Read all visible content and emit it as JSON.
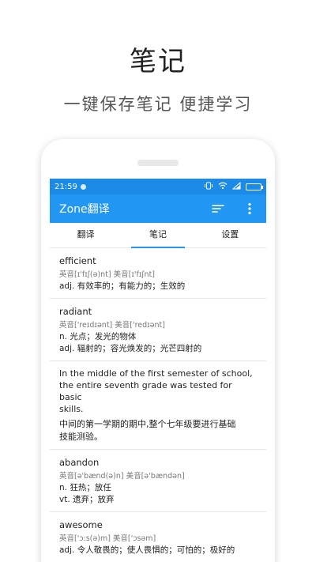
{
  "promo": {
    "title": "笔记",
    "subtitle": "一键保存笔记  便捷学习"
  },
  "status_bar": {
    "time": "21:59"
  },
  "app_bar": {
    "title": "Zone翻译"
  },
  "tabs": [
    {
      "label": "翻译",
      "active": false
    },
    {
      "label": "笔记",
      "active": true
    },
    {
      "label": "设置",
      "active": false
    }
  ],
  "entries": [
    {
      "word": "efficient",
      "phonetic": "英音[ɪ'fɪʃ(ə)nt] 美音[ɪ'fɪʃnt]",
      "meanings": [
        "adj. 有效率的；有能力的；生效的"
      ]
    },
    {
      "word": "radiant",
      "phonetic": "英音['reɪdɪənt] 美音['redɪənt]",
      "meanings": [
        "n. 光点；发光的物体",
        "adj. 辐射的；容光焕发的；光芒四射的"
      ]
    },
    {
      "sentence_lines": [
        "In the middle of the first semester of school,",
        "the entire seventh grade was tested for basic",
        "skills."
      ],
      "translation_lines": [
        "中间的第一学期的期中,整个七年级要进行基础",
        "技能测验。"
      ]
    },
    {
      "word": "abandon",
      "phonetic": "英音[ə'bænd(ə)n] 美音[ə'bændən]",
      "meanings": [
        "n. 狂热；放任",
        "vt. 遗弃；放弃"
      ]
    },
    {
      "word": "awesome",
      "phonetic": "英音['ɔ:s(ə)m] 美音['ɔsəm]",
      "meanings": [
        "adj. 令人敬畏的；使人畏惧的；可怕的；极好的"
      ]
    }
  ],
  "colors": {
    "primary": "#2196f3",
    "status_bar": "#1c8be8",
    "divider": "#e6e6e6"
  },
  "icons": {
    "app_bar": [
      "sort-icon",
      "more-vert-icon"
    ],
    "status_bar": [
      "notification-dot-icon",
      "vibrate-icon",
      "wifi-icon",
      "signal-icon",
      "battery-icon"
    ]
  }
}
